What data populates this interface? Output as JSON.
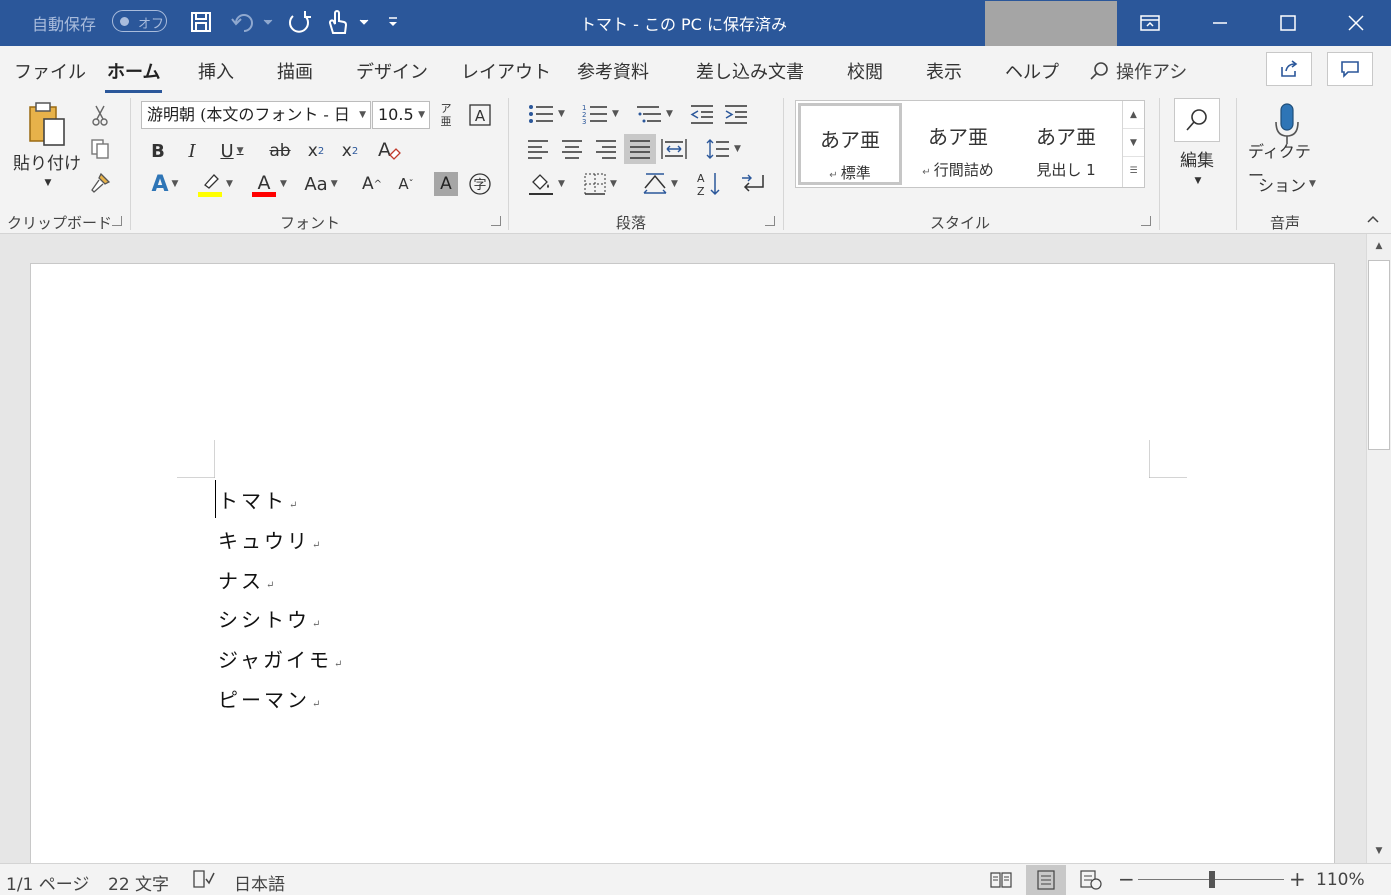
{
  "titlebar": {
    "autosave_label": "自動保存",
    "autosave_state": "オフ",
    "document_title": "トマト - この PC に保存済み",
    "bg_color": "#2b579a"
  },
  "tabs": [
    {
      "label": "ファイル"
    },
    {
      "label": "ホーム",
      "active": true
    },
    {
      "label": "挿入"
    },
    {
      "label": "描画"
    },
    {
      "label": "デザイン"
    },
    {
      "label": "レイアウト"
    },
    {
      "label": "参考資料"
    },
    {
      "label": "差し込み文書"
    },
    {
      "label": "校閲"
    },
    {
      "label": "表示"
    },
    {
      "label": "ヘルプ"
    }
  ],
  "tell_me": "操作アシ",
  "ribbon": {
    "clipboard": {
      "paste_label": "貼り付け",
      "group_label": "クリップボード"
    },
    "font": {
      "font_name": "游明朝 (本文のフォント - 日",
      "font_size": "10.5",
      "phonetic_label": "亜",
      "phonetic_top": "ア",
      "group_label": "フォント"
    },
    "paragraph": {
      "group_label": "段落"
    },
    "styles": {
      "items": [
        {
          "sample": "あア亜",
          "name": "標準"
        },
        {
          "sample": "あア亜",
          "name": "行間詰め"
        },
        {
          "sample": "あア亜",
          "name": "見出し 1"
        }
      ],
      "group_label": "スタイル"
    },
    "editing": {
      "label": "編集"
    },
    "voice": {
      "label_line1": "ディクテー",
      "label_line2": "ション",
      "group_label": "音声"
    }
  },
  "document": {
    "lines": [
      "トマト",
      "キュウリ",
      "ナス",
      "シシトウ",
      "ジャガイモ",
      "ピーマン"
    ]
  },
  "statusbar": {
    "page": "1/1 ページ",
    "words": "22 文字",
    "language": "日本語",
    "zoom": "110%"
  }
}
